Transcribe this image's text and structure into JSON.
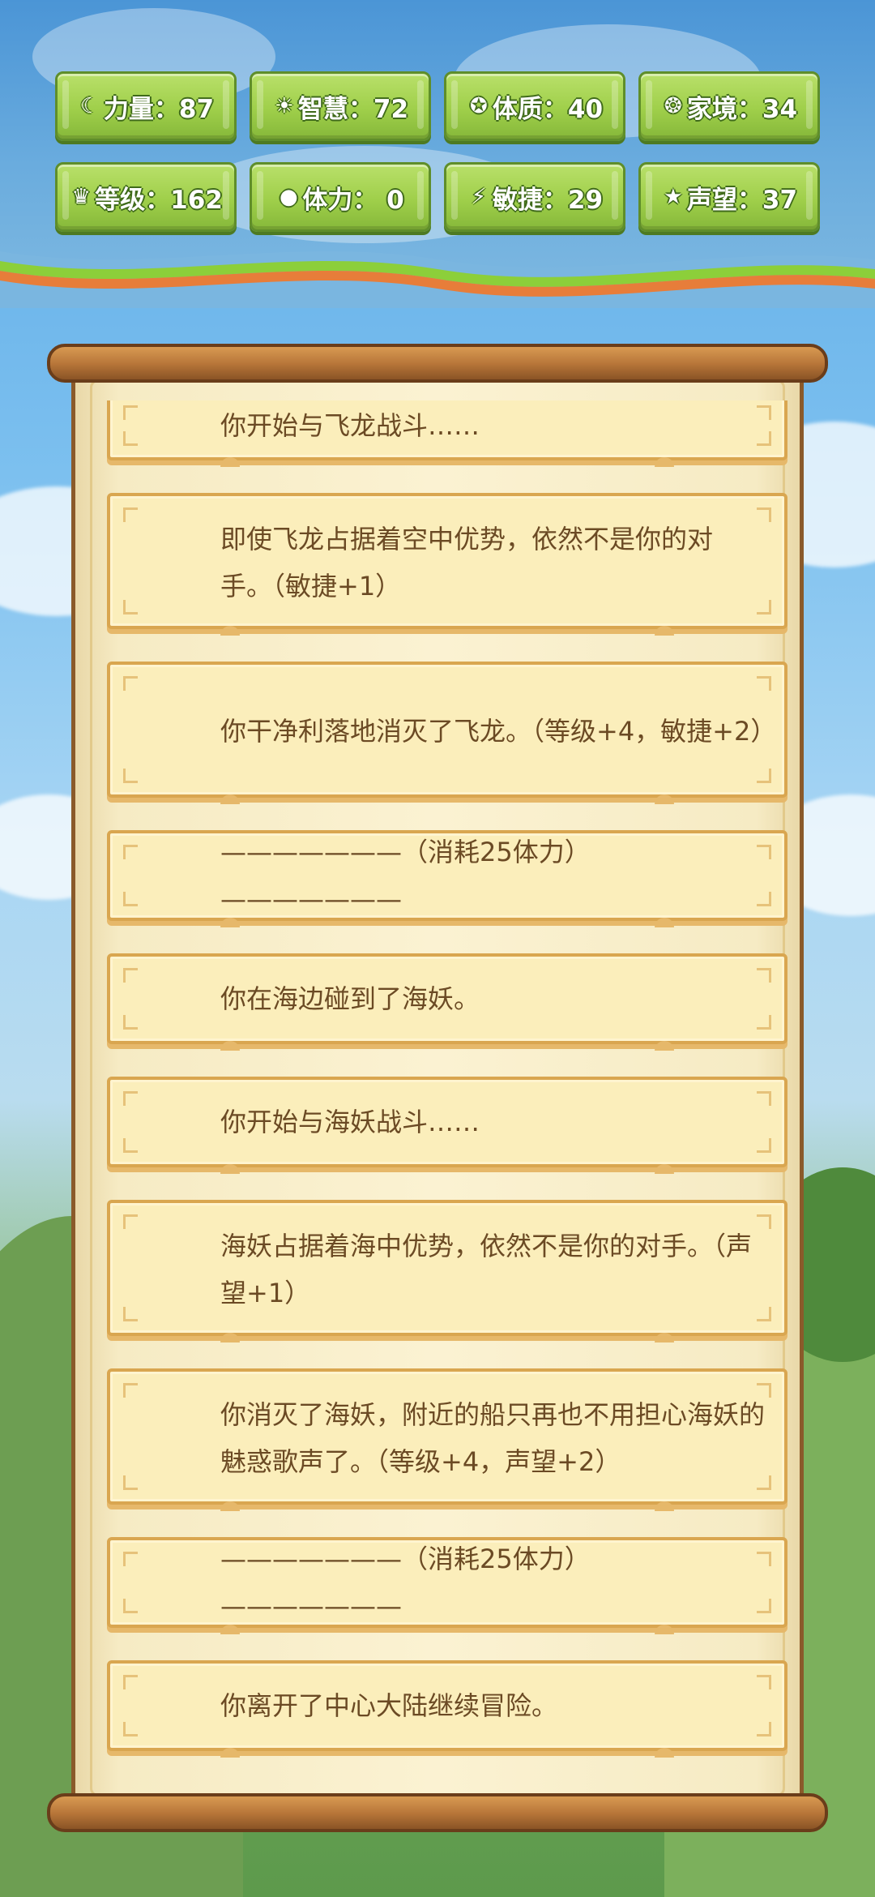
{
  "stats": [
    {
      "icon": "strength-icon",
      "glyph": "☾",
      "label": "力量：87"
    },
    {
      "icon": "wisdom-icon",
      "glyph": "☀",
      "label": "智慧：72"
    },
    {
      "icon": "constitution-icon",
      "glyph": "✪",
      "label": "体质：40"
    },
    {
      "icon": "family-icon",
      "glyph": "❂",
      "label": "家境：34"
    },
    {
      "icon": "crown-icon",
      "glyph": "♛",
      "label": "等级：162"
    },
    {
      "icon": "stamina-icon",
      "glyph": "●",
      "label": "体力： 0"
    },
    {
      "icon": "lightning-icon",
      "glyph": "⚡",
      "label": "敏捷：29"
    },
    {
      "icon": "star-icon",
      "glyph": "★",
      "label": "声望：37"
    }
  ],
  "log": [
    "你开始与飞龙战斗……",
    "即使飞龙占据着空中优势，依然不是你的对手。（敏捷+1）",
    "你干净利落地消灭了飞龙。（等级+4，敏捷+2）",
    "———————（消耗25体力）———————",
    "你在海边碰到了海妖。",
    "你开始与海妖战斗……",
    "海妖占据着海中优势，依然不是你的对手。（声望+1）",
    "你消灭了海妖，附近的船只再也不用担心海妖的魅惑歌声了。（等级+4，声望+2）",
    "———————（消耗25体力）———————",
    "你离开了中心大陆继续冒险。"
  ]
}
